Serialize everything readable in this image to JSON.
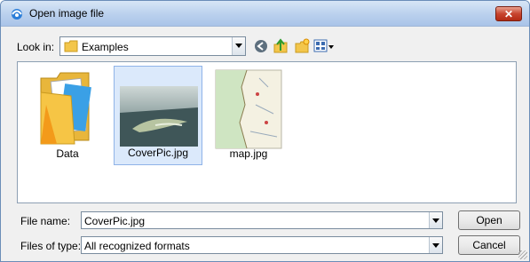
{
  "dialog": {
    "title": "Open image file",
    "close_label": "✕"
  },
  "look_in": {
    "label": "Look in:",
    "value": "Examples"
  },
  "toolbar": {
    "icons": [
      "back-icon",
      "up-folder-icon",
      "new-folder-icon",
      "view-menu-icon"
    ]
  },
  "files": [
    {
      "name": "Data",
      "kind": "folder",
      "selected": false
    },
    {
      "name": "CoverPic.jpg",
      "kind": "image",
      "selected": true
    },
    {
      "name": "map.jpg",
      "kind": "image",
      "selected": false
    }
  ],
  "file_name": {
    "label": "File name:",
    "value": "CoverPic.jpg"
  },
  "file_type": {
    "label": "Files of type:",
    "value": "All recognized formats"
  },
  "buttons": {
    "open": "Open",
    "cancel": "Cancel"
  }
}
